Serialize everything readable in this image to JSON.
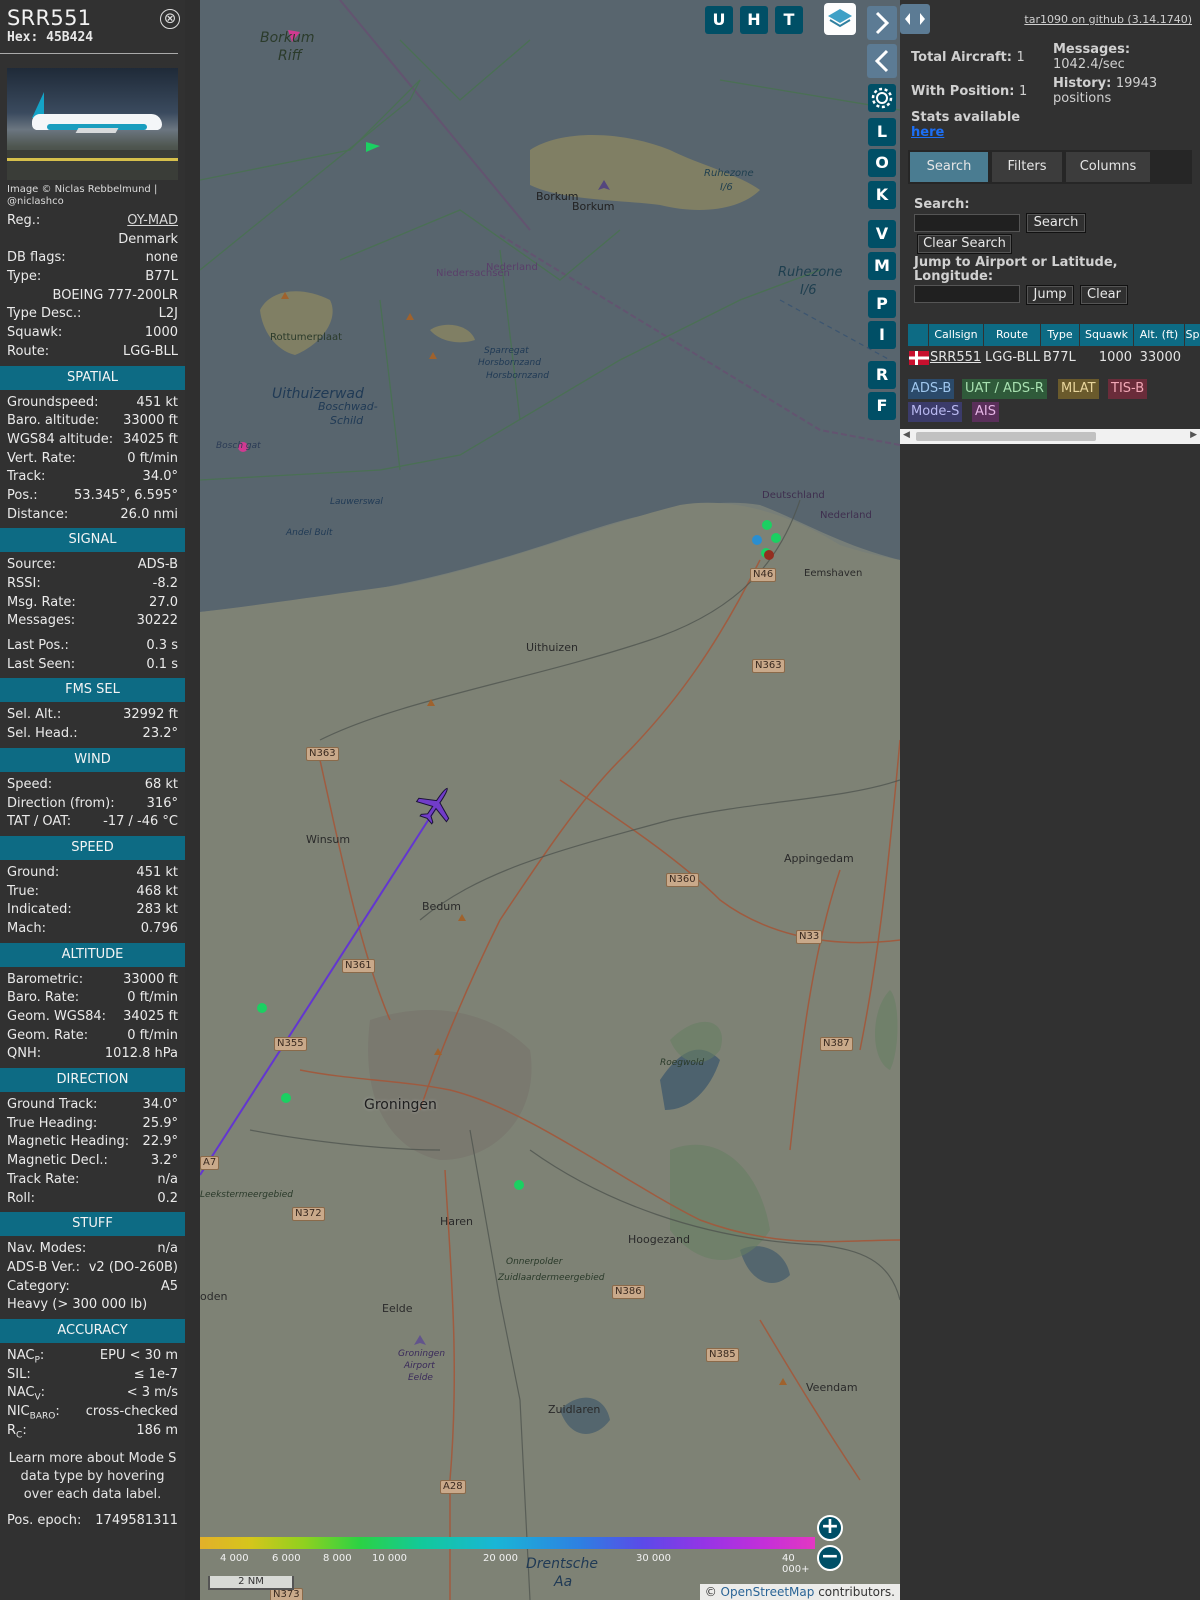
{
  "info": {
    "callsign": "SRR551",
    "hex_label": "Hex:",
    "hex": "45B424",
    "close_glyph": "⊗",
    "photo_credit": "Image © Niclas Rebbelmund | @niclashco",
    "top_rows": [
      {
        "k": "Reg.:",
        "v": "OY-MAD",
        "link": true
      },
      {
        "k": "",
        "v": "Denmark"
      },
      {
        "k": "DB flags:",
        "v": "none"
      },
      {
        "k": "Type:",
        "v": "B77L"
      },
      {
        "k": "",
        "v": "BOEING 777-200LR"
      },
      {
        "k": "Type Desc.:",
        "v": "L2J"
      },
      {
        "k": "Squawk:",
        "v": "1000"
      },
      {
        "k": "Route:",
        "v": "LGG-BLL"
      }
    ],
    "sections": [
      {
        "title": "SPATIAL",
        "rows": [
          {
            "k": "Groundspeed:",
            "v": "451 kt"
          },
          {
            "k": "Baro. altitude:",
            "v": "33000 ft"
          },
          {
            "k": "WGS84 altitude:",
            "v": "34025 ft"
          },
          {
            "k": "Vert. Rate:",
            "v": "0 ft/min"
          },
          {
            "k": "Track:",
            "v": "34.0°"
          },
          {
            "k": "Pos.:",
            "v": "53.345°, 6.595°"
          },
          {
            "k": "Distance:",
            "v": "26.0 nmi"
          }
        ]
      },
      {
        "title": "SIGNAL",
        "rows": [
          {
            "k": "Source:",
            "v": "ADS-B"
          },
          {
            "k": "RSSI:",
            "v": "-8.2"
          },
          {
            "k": "Msg. Rate:",
            "v": "27.0"
          },
          {
            "k": "Messages:",
            "v": "30222"
          },
          {
            "gap": true
          },
          {
            "k": "Last Pos.:",
            "v": "0.3 s"
          },
          {
            "k": "Last Seen:",
            "v": "0.1 s"
          }
        ]
      },
      {
        "title": "FMS SEL",
        "rows": [
          {
            "k": "Sel. Alt.:",
            "v": "32992 ft"
          },
          {
            "k": "Sel. Head.:",
            "v": "23.2°"
          }
        ]
      },
      {
        "title": "WIND",
        "rows": [
          {
            "k": "Speed:",
            "v": "68 kt"
          },
          {
            "k": "Direction (from):",
            "v": "316°"
          },
          {
            "k": "TAT / OAT:",
            "v": "-17 / -46 °C"
          }
        ]
      },
      {
        "title": "SPEED",
        "rows": [
          {
            "k": "Ground:",
            "v": "451 kt"
          },
          {
            "k": "True:",
            "v": "468 kt"
          },
          {
            "k": "Indicated:",
            "v": "283 kt"
          },
          {
            "k": "Mach:",
            "v": "0.796"
          }
        ]
      },
      {
        "title": "ALTITUDE",
        "rows": [
          {
            "k": "Barometric:",
            "v": "33000 ft"
          },
          {
            "k": "Baro. Rate:",
            "v": "0 ft/min"
          },
          {
            "k": "Geom. WGS84:",
            "v": "34025 ft"
          },
          {
            "k": "Geom. Rate:",
            "v": "0 ft/min"
          },
          {
            "k": "QNH:",
            "v": "1012.8 hPa"
          }
        ]
      },
      {
        "title": "DIRECTION",
        "rows": [
          {
            "k": "Ground Track:",
            "v": "34.0°"
          },
          {
            "k": "True Heading:",
            "v": "25.9°"
          },
          {
            "k": "Magnetic Heading:",
            "v": "22.9°"
          },
          {
            "k": "Magnetic Decl.:",
            "v": "3.2°"
          },
          {
            "k": "Track Rate:",
            "v": "n/a"
          },
          {
            "k": "Roll:",
            "v": "0.2"
          }
        ]
      },
      {
        "title": "STUFF",
        "rows": [
          {
            "k": "Nav. Modes:",
            "v": "n/a"
          },
          {
            "k": "ADS-B Ver.:",
            "v": "v2 (DO-260B)"
          },
          {
            "k": "Category:",
            "v": "A5"
          },
          {
            "k": "Heavy (> 300 000 lb)",
            "v": ""
          }
        ]
      },
      {
        "title": "ACCURACY",
        "rows": [
          {
            "k": "NAC",
            "sub": "P",
            "v": "EPU < 30 m"
          },
          {
            "k": "SIL:",
            "v": "≤ 1e-7"
          },
          {
            "k": "NAC",
            "sub": "V",
            "v": "< 3 m/s"
          },
          {
            "k": "NIC",
            "sub": "BARO",
            "v": "cross-checked"
          },
          {
            "k": "R",
            "sub": "C",
            "v": "186 m"
          }
        ]
      }
    ],
    "note": "Learn more about Mode S data type by hovering over each data label.",
    "epoch_label": "Pos. epoch:",
    "epoch": "1749581311"
  },
  "map": {
    "top_buttons": [
      "U",
      "H",
      "T"
    ],
    "side_buttons": [
      "L",
      "O",
      "K",
      "V",
      "M",
      "P",
      "I",
      "R",
      "F"
    ],
    "settings_icon": "gear-icon",
    "layers_icon": "layers-icon",
    "attribution_prefix": "© ",
    "attribution_link": "OpenStreetMap",
    "attribution_suffix": " contributors.",
    "scale_label": "2 NM",
    "altitude_labels": [
      "4 000",
      "6 000",
      "8 000",
      "10 000",
      "20 000",
      "30 000",
      "40 000+"
    ],
    "place_labels": [
      {
        "t": "Borkum",
        "k": "Borkum"
      },
      {
        "t": "Riff",
        "k": "Riff"
      },
      {
        "t": "Borkum",
        "k": "Borkum2"
      },
      {
        "t": "Borkum",
        "k": "Borkum3"
      },
      {
        "t": "Ruhezone",
        "k": "Rz1"
      },
      {
        "t": "I/6",
        "k": "Rz1b"
      },
      {
        "t": "Ruhezone",
        "k": "Rz2"
      },
      {
        "t": "I/6",
        "k": "Rz2b"
      },
      {
        "t": "Rottumerplaat",
        "k": "Rottumerplaat"
      },
      {
        "t": "Uithuizerwad",
        "k": "Uithuizerwad"
      },
      {
        "t": "Boschwad-",
        "k": "Boschwad"
      },
      {
        "t": "Schild",
        "k": "Schild"
      },
      {
        "t": "Sparregat",
        "k": "Sparregat"
      },
      {
        "t": "Horsbornzand",
        "k": "Horsbornzand"
      },
      {
        "t": "Horsbornzand",
        "k": "Horsbornzand2"
      },
      {
        "t": "Bosch gat",
        "k": "Boschgat"
      },
      {
        "t": "Lauwerswal",
        "k": "Lauwerswal"
      },
      {
        "t": "Andel Bult",
        "k": "AndelBult"
      },
      {
        "t": "Deutschland",
        "k": "Deutschland"
      },
      {
        "t": "Nederland",
        "k": "Nederland"
      },
      {
        "t": "Nederland",
        "k": "Nederland2"
      },
      {
        "t": "Niedersachsen",
        "k": "Niedersachsen"
      },
      {
        "t": "Eemshaven",
        "k": "Eemshaven"
      },
      {
        "t": "Uithuizen",
        "k": "Uithuizen"
      },
      {
        "t": "Winsum",
        "k": "Winsum"
      },
      {
        "t": "Bedum",
        "k": "Bedum"
      },
      {
        "t": "Appingedam",
        "k": "Appingedam"
      },
      {
        "t": "Groningen",
        "k": "Groningen"
      },
      {
        "t": "Haren",
        "k": "Haren"
      },
      {
        "t": "Hoogezand",
        "k": "Hoogezand"
      },
      {
        "t": "Onnerpolder",
        "k": "Onnerpolder"
      },
      {
        "t": "Zuidlaardermeergebied",
        "k": "Zuidlaardermeergebied"
      },
      {
        "t": "Leekstermeergebied",
        "k": "Leekster"
      },
      {
        "t": "Eelde",
        "k": "Eelde"
      },
      {
        "t": "Groningen",
        "k": "GRQ1"
      },
      {
        "t": "Airport",
        "k": "GRQ2"
      },
      {
        "t": "Eelde",
        "k": "GRQ3"
      },
      {
        "t": "Zuidlaren",
        "k": "Zuidlaren"
      },
      {
        "t": "Veendam",
        "k": "Veendam"
      },
      {
        "t": "Roegwold",
        "k": "Roegwold"
      },
      {
        "t": "Drentsche",
        "k": "Drentsche"
      },
      {
        "t": "Aa",
        "k": "Aa"
      },
      {
        "t": "oden",
        "k": "oden"
      }
    ],
    "road_labels": [
      "N46",
      "N363",
      "N363",
      "N360",
      "N33",
      "N361",
      "N355",
      "N387",
      "A7",
      "N372",
      "N386",
      "N385",
      "A28",
      "N373"
    ]
  },
  "sidebar": {
    "toggle_glyph": "◂▸",
    "github_link": "tar1090 on github (3.14.1740)",
    "total_label": "Total Aircraft:",
    "total_value": "1",
    "messages_label": "Messages:",
    "messages_value": "1042.4/sec",
    "withpos_label": "With Position:",
    "withpos_value": "1",
    "history_label": "History:",
    "history_value": "19943",
    "history_unit": "positions",
    "stats_label": "Stats available",
    "stats_link": "here",
    "tabs": [
      "Search",
      "Filters",
      "Columns"
    ],
    "search_label": "Search:",
    "search_button": "Search",
    "clear_search_button": "Clear Search",
    "jump_label": "Jump to Airport or Latitude, Longitude:",
    "jump_button": "Jump",
    "clear_button": "Clear",
    "table_headers": [
      "Callsign",
      "Route",
      "Type",
      "Squawk",
      "Alt. (ft)",
      "Sp"
    ],
    "table_row": {
      "callsign": "SRR551",
      "route": "LGG-BLL",
      "type": "B77L",
      "squawk": "1000",
      "alt": "33000"
    },
    "legend_chips": [
      {
        "t": "ADS-B",
        "bg": "#2b4a6a",
        "fg": "#9fc7ee"
      },
      {
        "t": "UAT / ADS-R",
        "bg": "#2f5a3a",
        "fg": "#a7e0b0"
      },
      {
        "t": "MLAT",
        "bg": "#6a5a2c",
        "fg": "#e8d59c"
      },
      {
        "t": "TIS-B",
        "bg": "#6a2c3a",
        "fg": "#f2a8b6"
      },
      {
        "t": "Mode-S",
        "bg": "#3b3b6a",
        "fg": "#b9b9f0"
      },
      {
        "t": "AIS",
        "bg": "#5a2f5a",
        "fg": "#e6b6e6"
      }
    ]
  },
  "colors": {
    "accent": "#0d6b84",
    "aircraft": "#7b3fe0",
    "track": "#6b38e8",
    "panel_bg": "#313131"
  }
}
